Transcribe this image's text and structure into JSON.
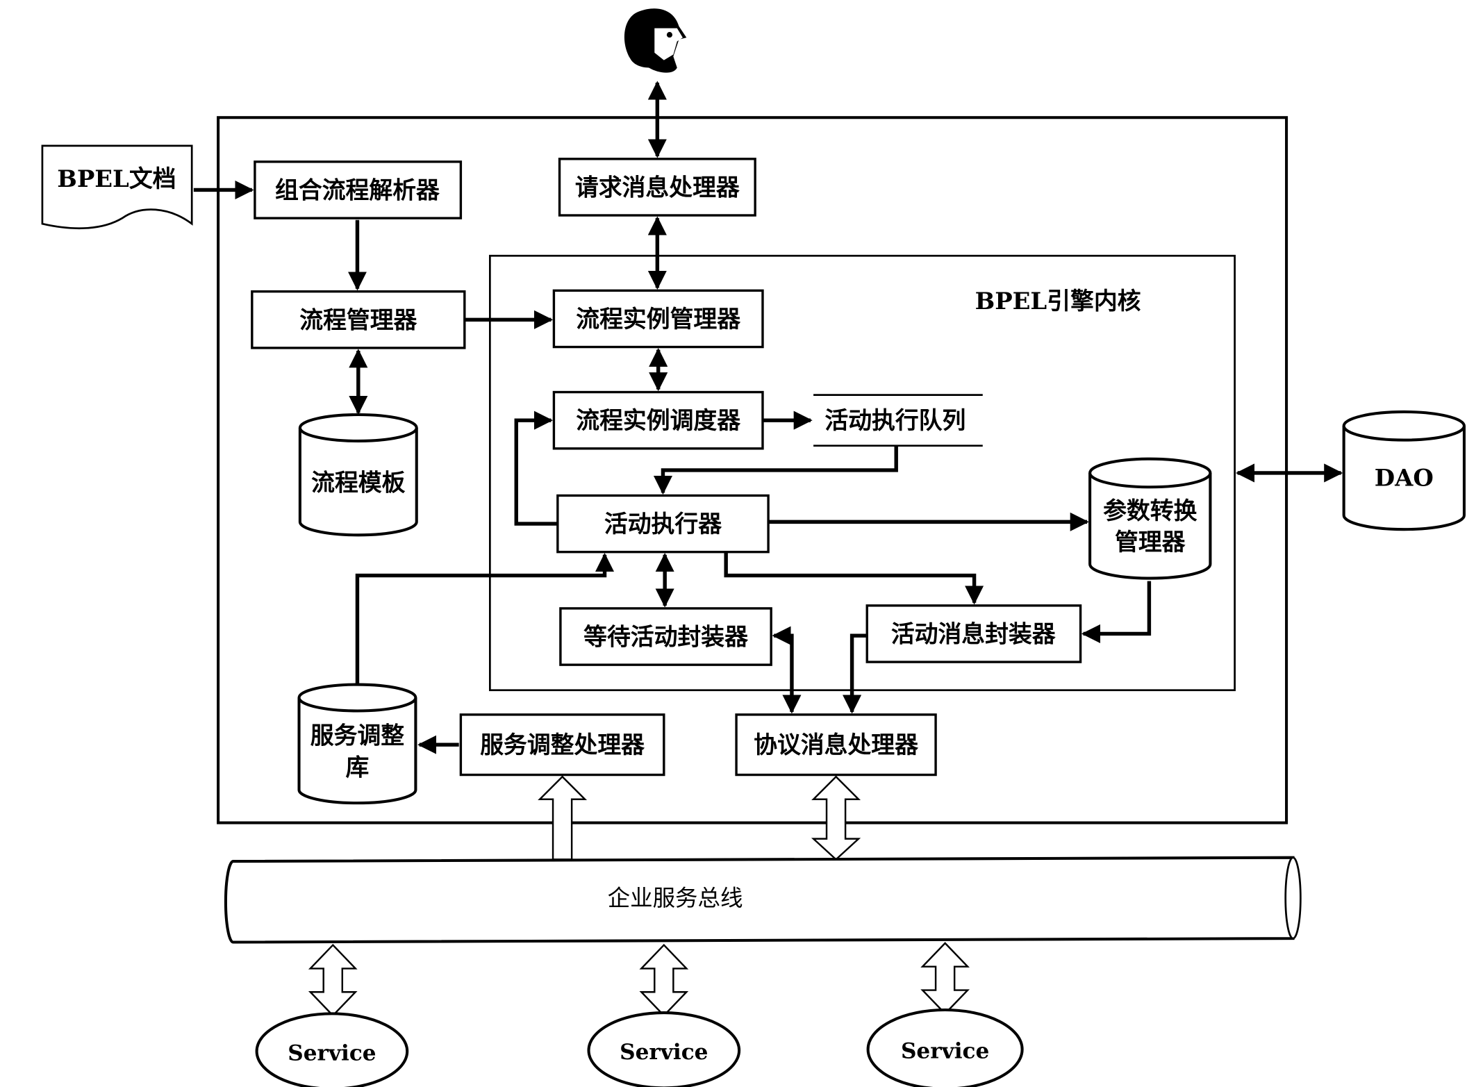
{
  "diagram": {
    "bpel_document": "BPEL文档",
    "engine_core_label": "BPEL引擎内核",
    "boxes": {
      "composite_process_parser": "组合流程解析器",
      "request_message_processor": "请求消息处理器",
      "process_manager": "流程管理器",
      "process_instance_manager": "流程实例管理器",
      "process_instance_scheduler": "流程实例调度器",
      "activity_execution_queue": "活动执行队列",
      "activity_executor": "活动执行器",
      "wait_activity_wrapper": "等待活动封装器",
      "activity_message_wrapper": "活动消息封装器",
      "service_adjustment_processor": "服务调整处理器",
      "protocol_message_processor": "协议消息处理器"
    },
    "databases": {
      "process_template": "流程模板",
      "param_conversion_manager_line1": "参数转换",
      "param_conversion_manager_line2": "管理器",
      "service_adjustment_repo_line1": "服务调整",
      "service_adjustment_repo_line2": "库",
      "dao": "DAO"
    },
    "bus": "企业服务总线",
    "services": [
      "Service",
      "Service",
      "Service"
    ],
    "actor": "user-icon"
  }
}
